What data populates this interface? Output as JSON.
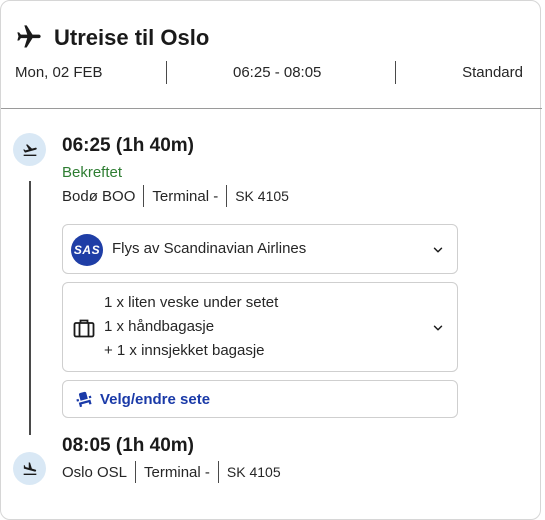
{
  "header": {
    "title": "Utreise til Oslo",
    "date": "Mon, 02 FEB",
    "time_range": "06:25 - 08:05",
    "fare_class": "Standard"
  },
  "departure": {
    "time_duration": "06:25  (1h 40m)",
    "status": "Bekreftet",
    "airport": "Bodø  BOO",
    "terminal": "Terminal  -",
    "flight_no": "SK 4105"
  },
  "airline": {
    "logo_text": "SAS",
    "text": "Flys av Scandinavian Airlines"
  },
  "baggage": {
    "lines": [
      "1 x liten veske under setet",
      "1 x håndbagasje",
      "+ 1 x innsjekket bagasje"
    ]
  },
  "seat": {
    "label": "Velg/endre sete"
  },
  "arrival": {
    "time_duration": "08:05  (1h 40m)",
    "airport": "Oslo  OSL",
    "terminal": "Terminal  -",
    "flight_no": "SK 4105"
  },
  "colors": {
    "status_green": "#2e7d32",
    "link_blue": "#1a3aa8",
    "sas_blue": "#1f3ea6",
    "timeline_icon_bg": "#d9e8f5"
  },
  "icons": {
    "header": "airplane-icon",
    "departure": "takeoff-icon",
    "arrival": "landing-icon",
    "baggage": "luggage-icon",
    "seat": "seat-icon",
    "expand": "chevron-down-icon"
  }
}
